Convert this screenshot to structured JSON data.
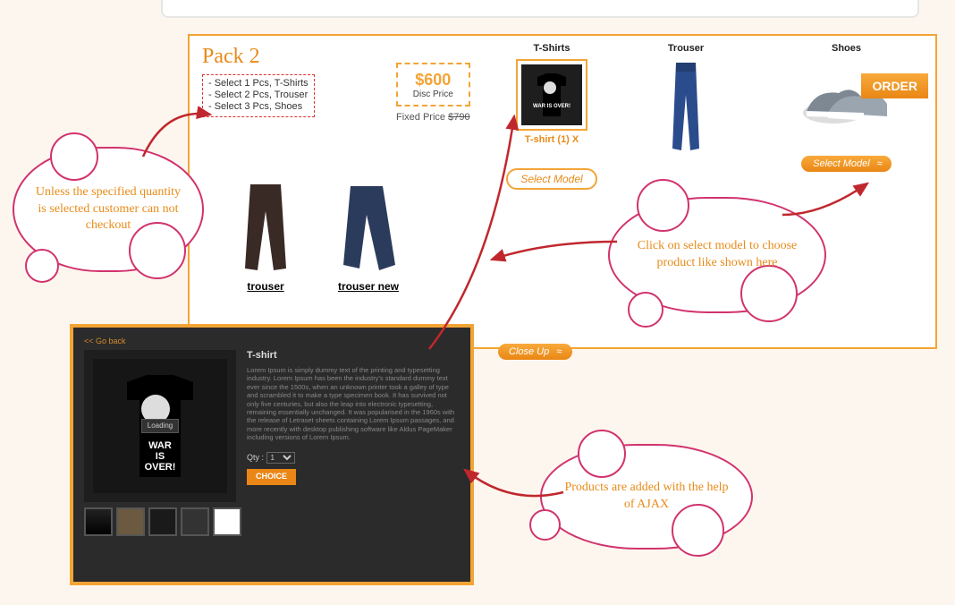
{
  "pack": {
    "title": "Pack 2",
    "rules": [
      "- Select 1 Pcs, T-Shirts",
      "- Select 2 Pcs, Trouser",
      "- Select 3 Pcs, Shoes"
    ],
    "disc_price": "$600",
    "disc_label": "Disc Price",
    "fixed_label": "Fixed Price",
    "fixed_price": "$790",
    "order_label": "ORDER",
    "closeup_label": "Close Up",
    "select_model_label": "Select Model",
    "columns": {
      "tshirts": {
        "header": "T-Shirts",
        "selected": "T-shirt (1) X"
      },
      "trouser": {
        "header": "Trouser"
      },
      "shoes": {
        "header": "Shoes"
      }
    },
    "lower_items": [
      "trouser",
      "trouser new"
    ]
  },
  "modal": {
    "go_back": "<< Go back",
    "title": "T-shirt",
    "loading": "Loading",
    "desc": "Lorem Ipsum is simply dummy text of the printing and typesetting industry. Lorem Ipsum has been the industry's standard dummy text ever since the 1500s, when an unknown printer took a galley of type and scrambled it to make a type specimen book. It has survived not only five centuries, but also the leap into electronic typesetting, remaining essentially unchanged. It was popularised in the 1960s with the release of Letraset sheets containing Lorem Ipsum passages, and more recently with desktop publishing software like Aldus PageMaker including versions of Lorem Ipsum.",
    "qty_label": "Qty :",
    "qty_value": "1",
    "choice_label": "CHOICE"
  },
  "callouts": {
    "c1": "Unless the specified quantity is selected customer can not checkout",
    "c2": "Click on select model to choose product like shown here",
    "c3": "Products are added with the help of AJAX"
  }
}
